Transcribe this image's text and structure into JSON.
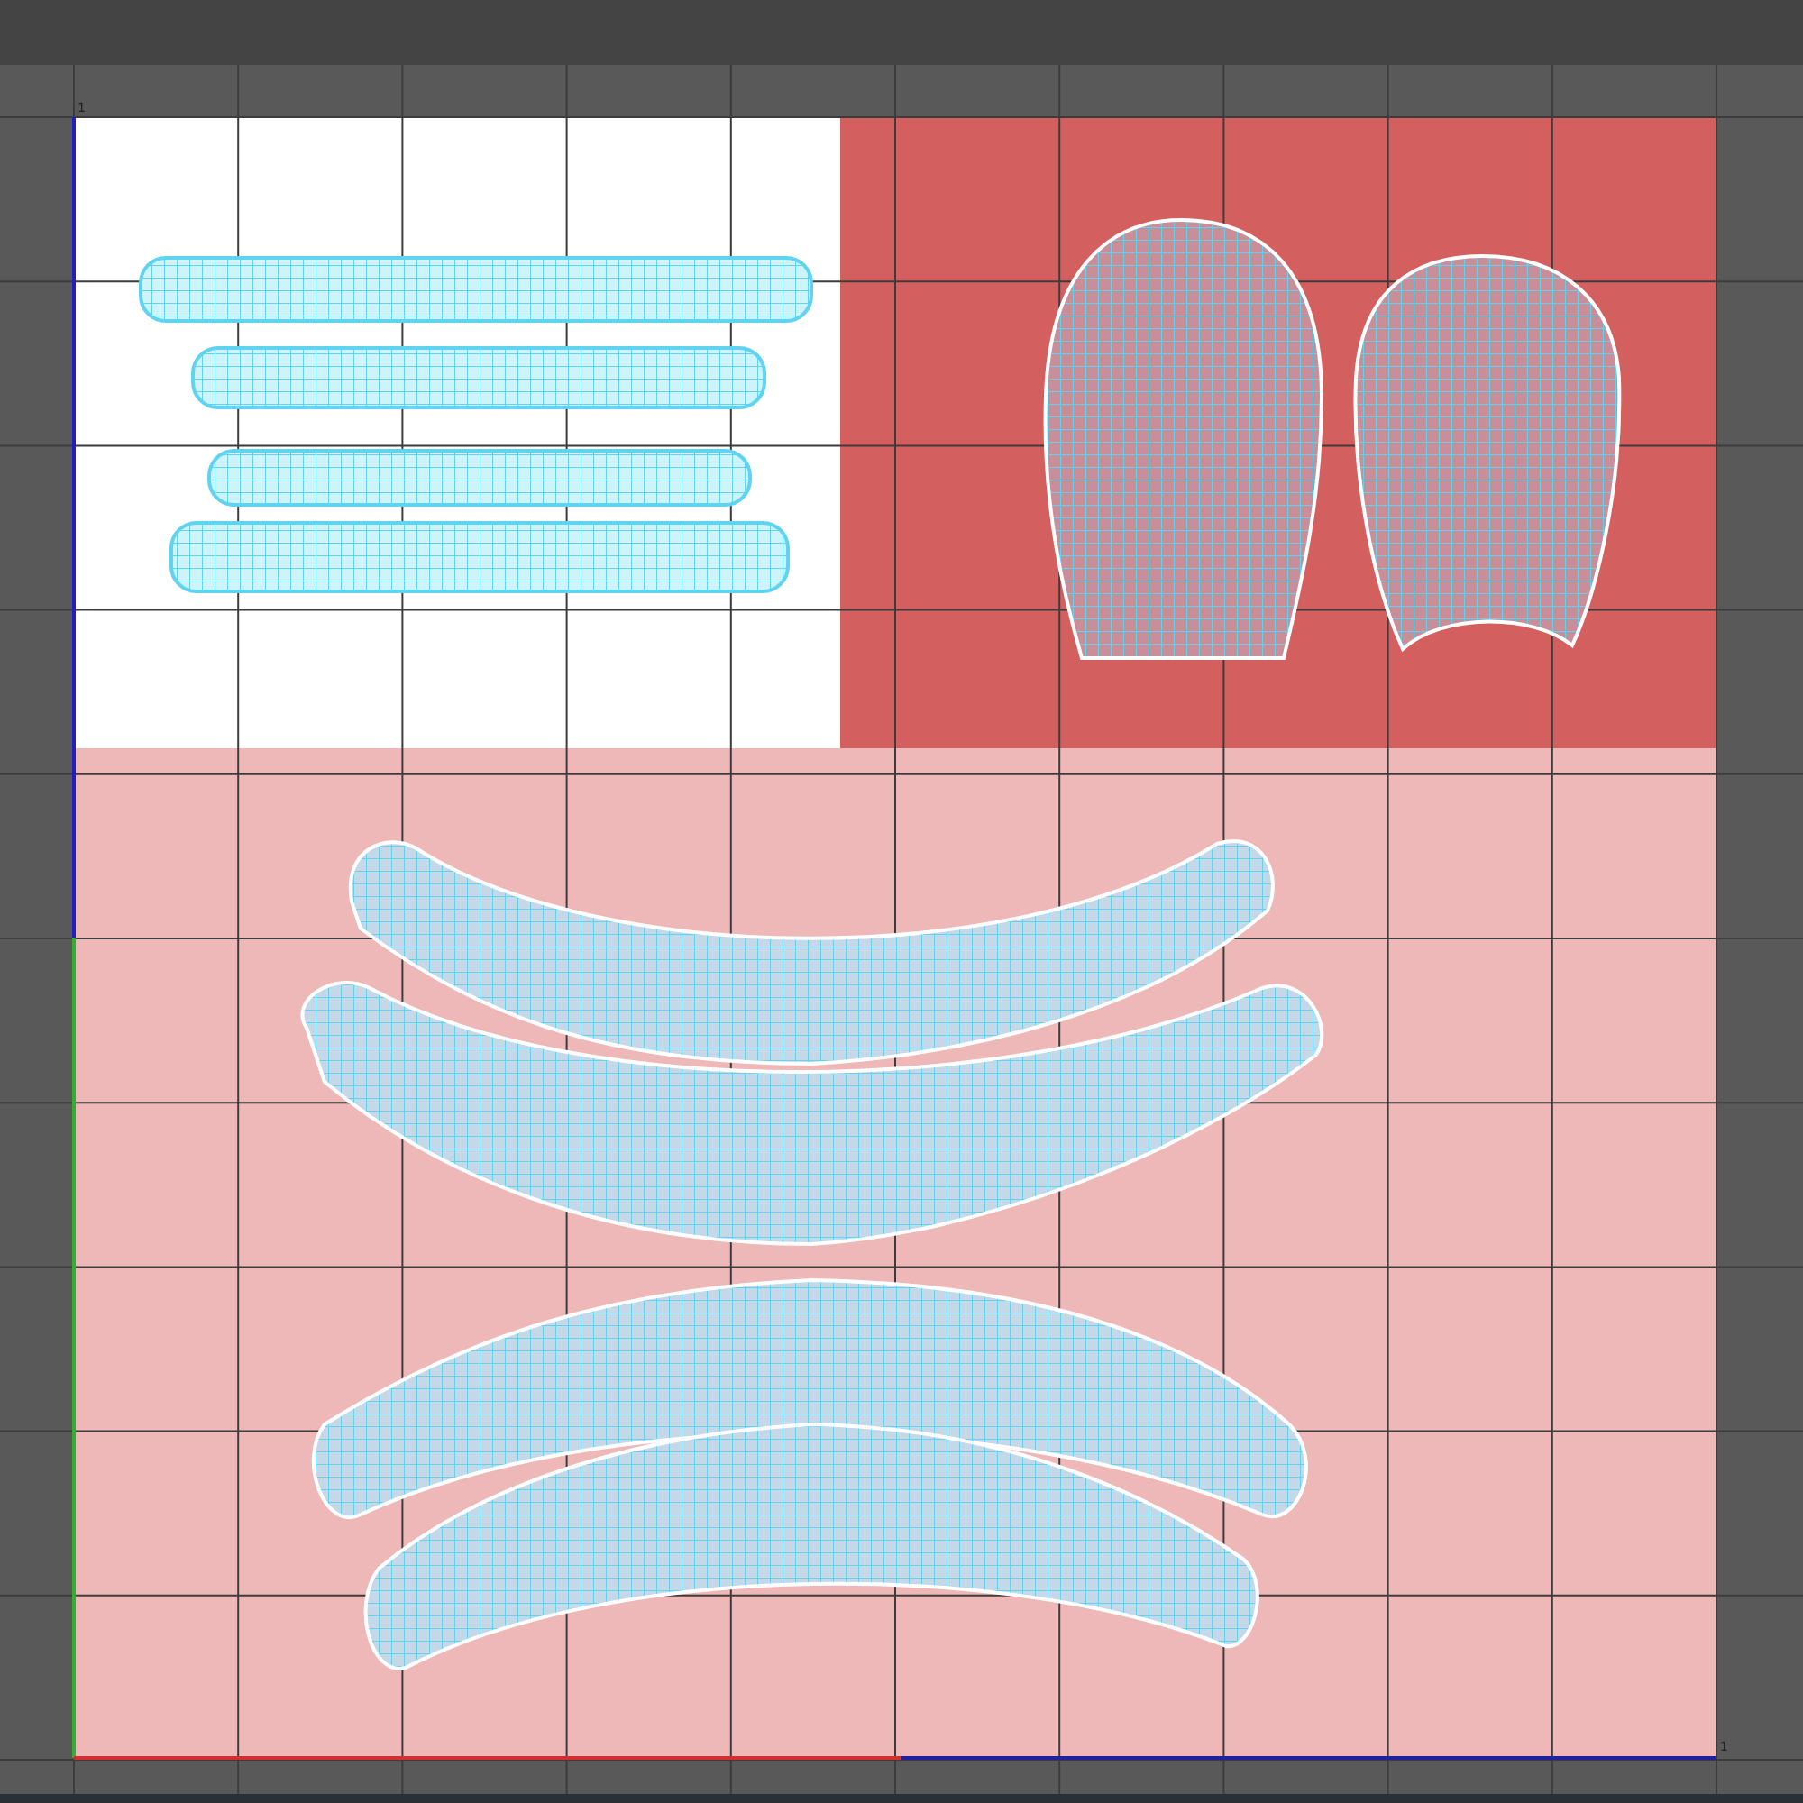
{
  "uv_editor": {
    "corner_labels": [
      "1",
      "1"
    ]
  }
}
